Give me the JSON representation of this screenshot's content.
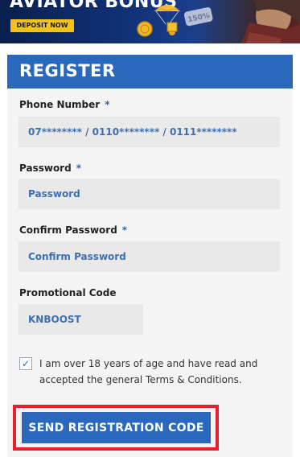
{
  "banner": {
    "title": "AVIATOR BONUS",
    "deposit_label": "DEPOSIT NOW",
    "badge_text": "150%"
  },
  "form": {
    "title": "REGISTER",
    "required_marker": "*",
    "phone": {
      "label": "Phone Number",
      "placeholder": "07******** / 0110******** / 0111********"
    },
    "password": {
      "label": "Password",
      "placeholder": "Password"
    },
    "confirm_password": {
      "label": "Confirm Password",
      "placeholder": "Confirm Password"
    },
    "promo": {
      "label": "Promotional Code",
      "value": "KNBOOST"
    },
    "terms": {
      "checked": true,
      "text": "I am over 18 years of age and have read and accepted the general Terms & Conditions."
    },
    "submit_label": "SEND REGISTRATION CODE"
  },
  "colors": {
    "brand_blue": "#2a68bd",
    "highlight_red": "#e1222b",
    "deposit_yellow": "#f5c218"
  }
}
